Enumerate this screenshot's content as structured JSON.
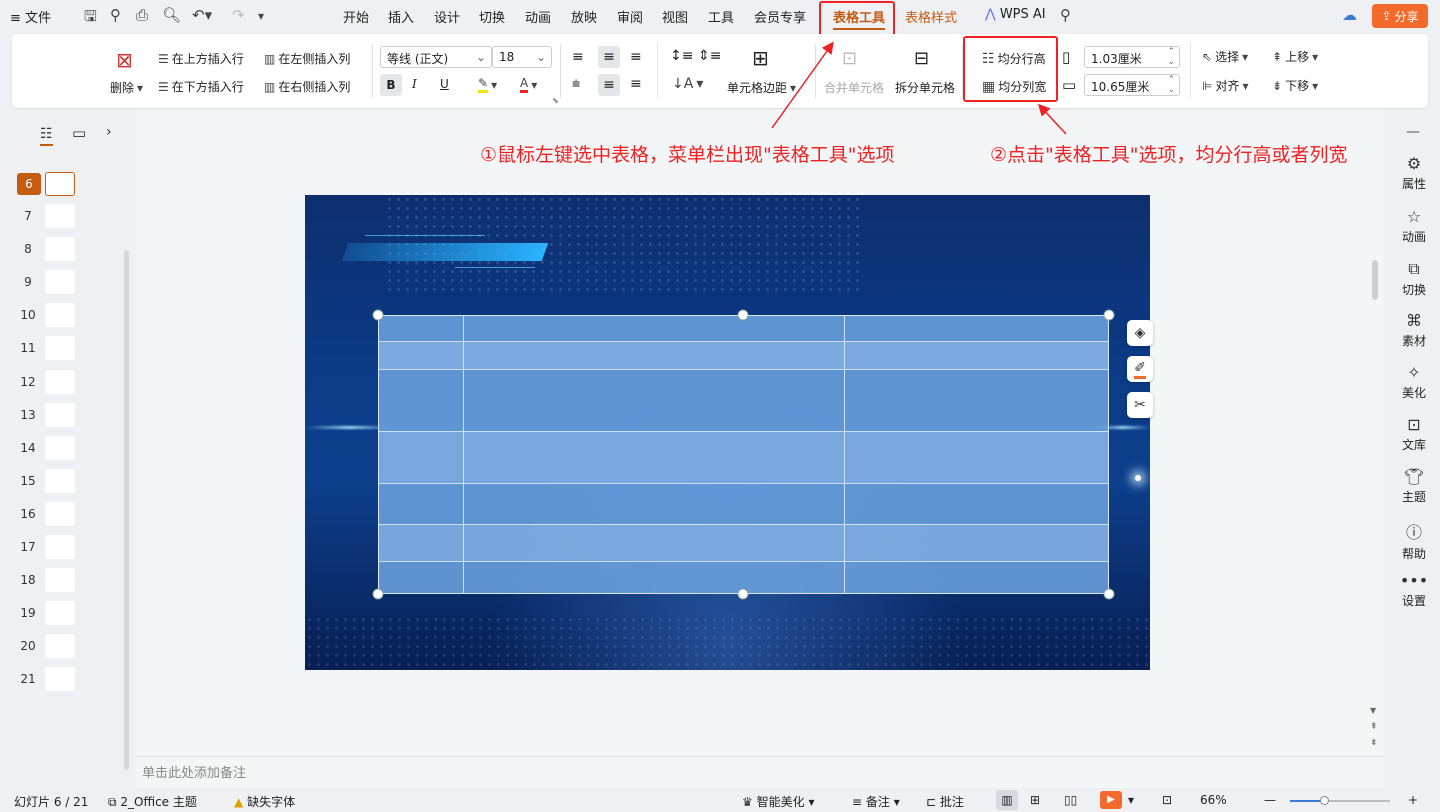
{
  "topbar": {
    "file": "文件",
    "tabs": [
      "开始",
      "插入",
      "设计",
      "切换",
      "动画",
      "放映",
      "审阅",
      "视图",
      "工具",
      "会员专享"
    ],
    "active_tab": "表格工具",
    "table_style_tab": "表格样式",
    "wps_ai": "WPS AI",
    "share": "分享"
  },
  "ribbon": {
    "delete": "删除",
    "insert_above": "在上方插入行",
    "insert_below": "在下方插入行",
    "insert_left": "在左侧插入列",
    "insert_right": "在右侧插入列",
    "font_name": "等线 (正文)",
    "font_size": "18",
    "bold": "B",
    "italic": "I",
    "underline": "U",
    "cell_margin": "单元格边距",
    "merge_cells": "合并单元格",
    "split_cells": "拆分单元格",
    "distribute_rows": "均分行高",
    "distribute_cols": "均分列宽",
    "row_height": "1.03厘米",
    "col_width": "10.65厘米",
    "select": "选择",
    "align": "对齐",
    "move_up": "上移",
    "move_down": "下移"
  },
  "annotations": {
    "step1": "①鼠标左键选中表格，菜单栏出现\"表格工具\"选项",
    "step2": "②点击\"表格工具\"选项，均分行高或者列宽"
  },
  "slides": {
    "current": "6",
    "numbers": [
      "7",
      "8",
      "9",
      "10",
      "11",
      "12",
      "13",
      "14",
      "15",
      "16",
      "17",
      "18",
      "19",
      "20",
      "21"
    ]
  },
  "right_panel": [
    "属性",
    "动画",
    "切换",
    "素材",
    "美化",
    "文库",
    "主题",
    "帮助",
    "设置"
  ],
  "notes_placeholder": "单击此处添加备注",
  "status": {
    "slide_info": "幻灯片 6 / 21",
    "theme": "2_Office 主题",
    "missing_font": "缺失字体",
    "smart_beautify": "智能美化",
    "notes": "备注",
    "comments": "批注",
    "zoom": "66%"
  },
  "colors": {
    "accent": "#c55a11",
    "annotation": "#e22222",
    "share_bg": "#f26b2b"
  }
}
